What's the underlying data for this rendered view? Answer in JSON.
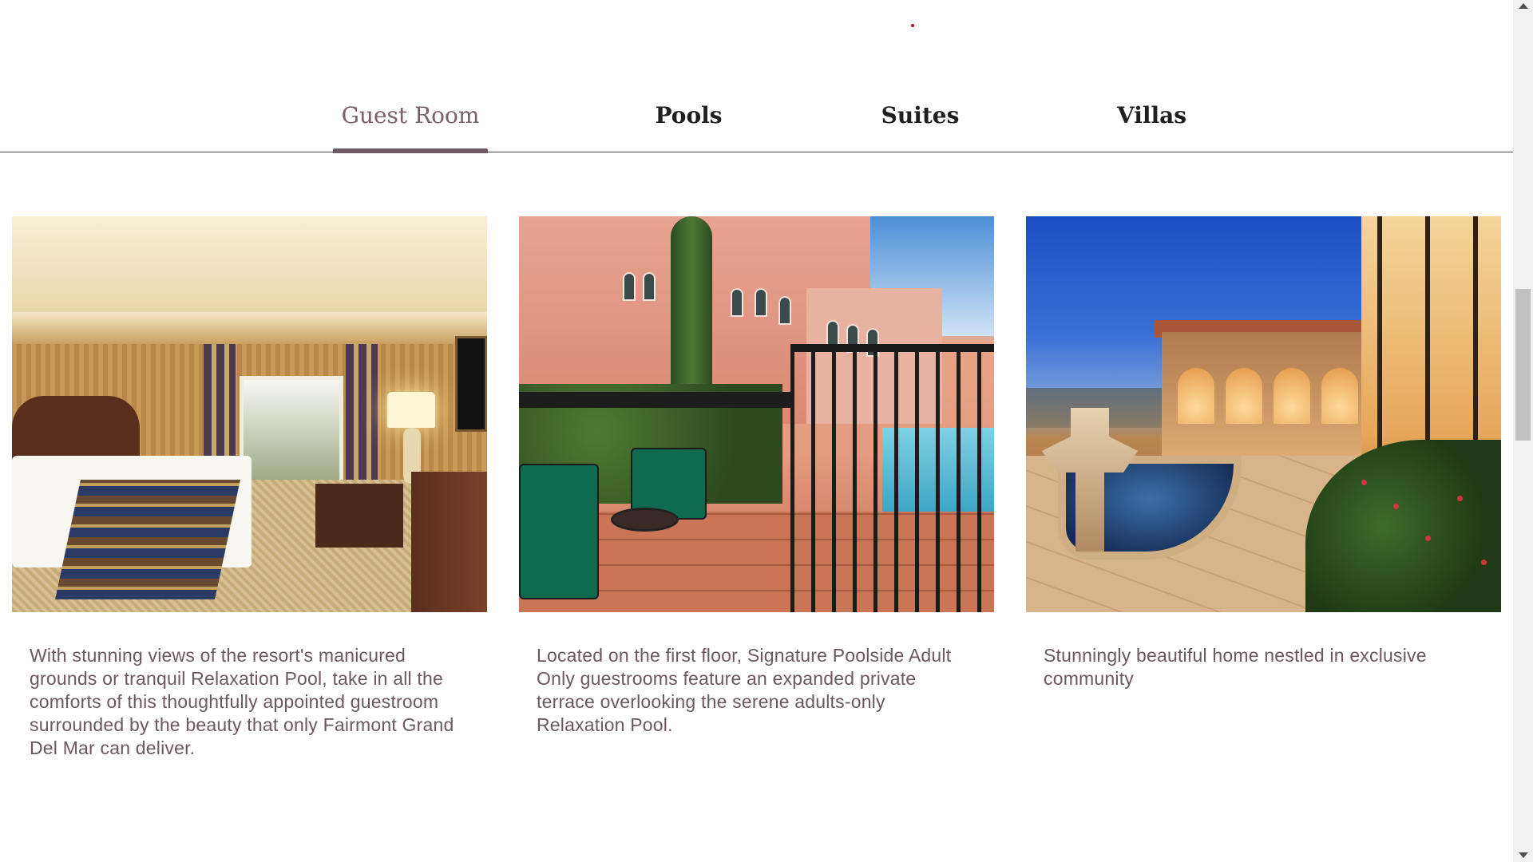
{
  "tabs": [
    {
      "label": "Guest Room",
      "active": true
    },
    {
      "label": "Pools",
      "active": false
    },
    {
      "label": "Suites",
      "active": false
    },
    {
      "label": "Villas",
      "active": false
    }
  ],
  "cards": [
    {
      "image": "guest-room-photo",
      "description": "With stunning views of the resort's manicured grounds or tranquil Relaxation Pool, take in all the comforts of this thoughtfully appointed guestroom surrounded by the beauty that only Fairmont Grand Del Mar can deliver."
    },
    {
      "image": "poolside-terrace-photo",
      "description": "Located on the first floor, Signature Poolside Adult Only guestrooms feature an expanded private terrace overlooking the serene adults-only Relaxation Pool."
    },
    {
      "image": "villa-photo",
      "description": "Stunningly beautiful home nestled in exclusive community"
    }
  ],
  "colors": {
    "active_tab": "#7a6068",
    "tab_text": "#1f1f1f",
    "body_text": "#6b5860",
    "accent_dot": "#d0021b"
  }
}
